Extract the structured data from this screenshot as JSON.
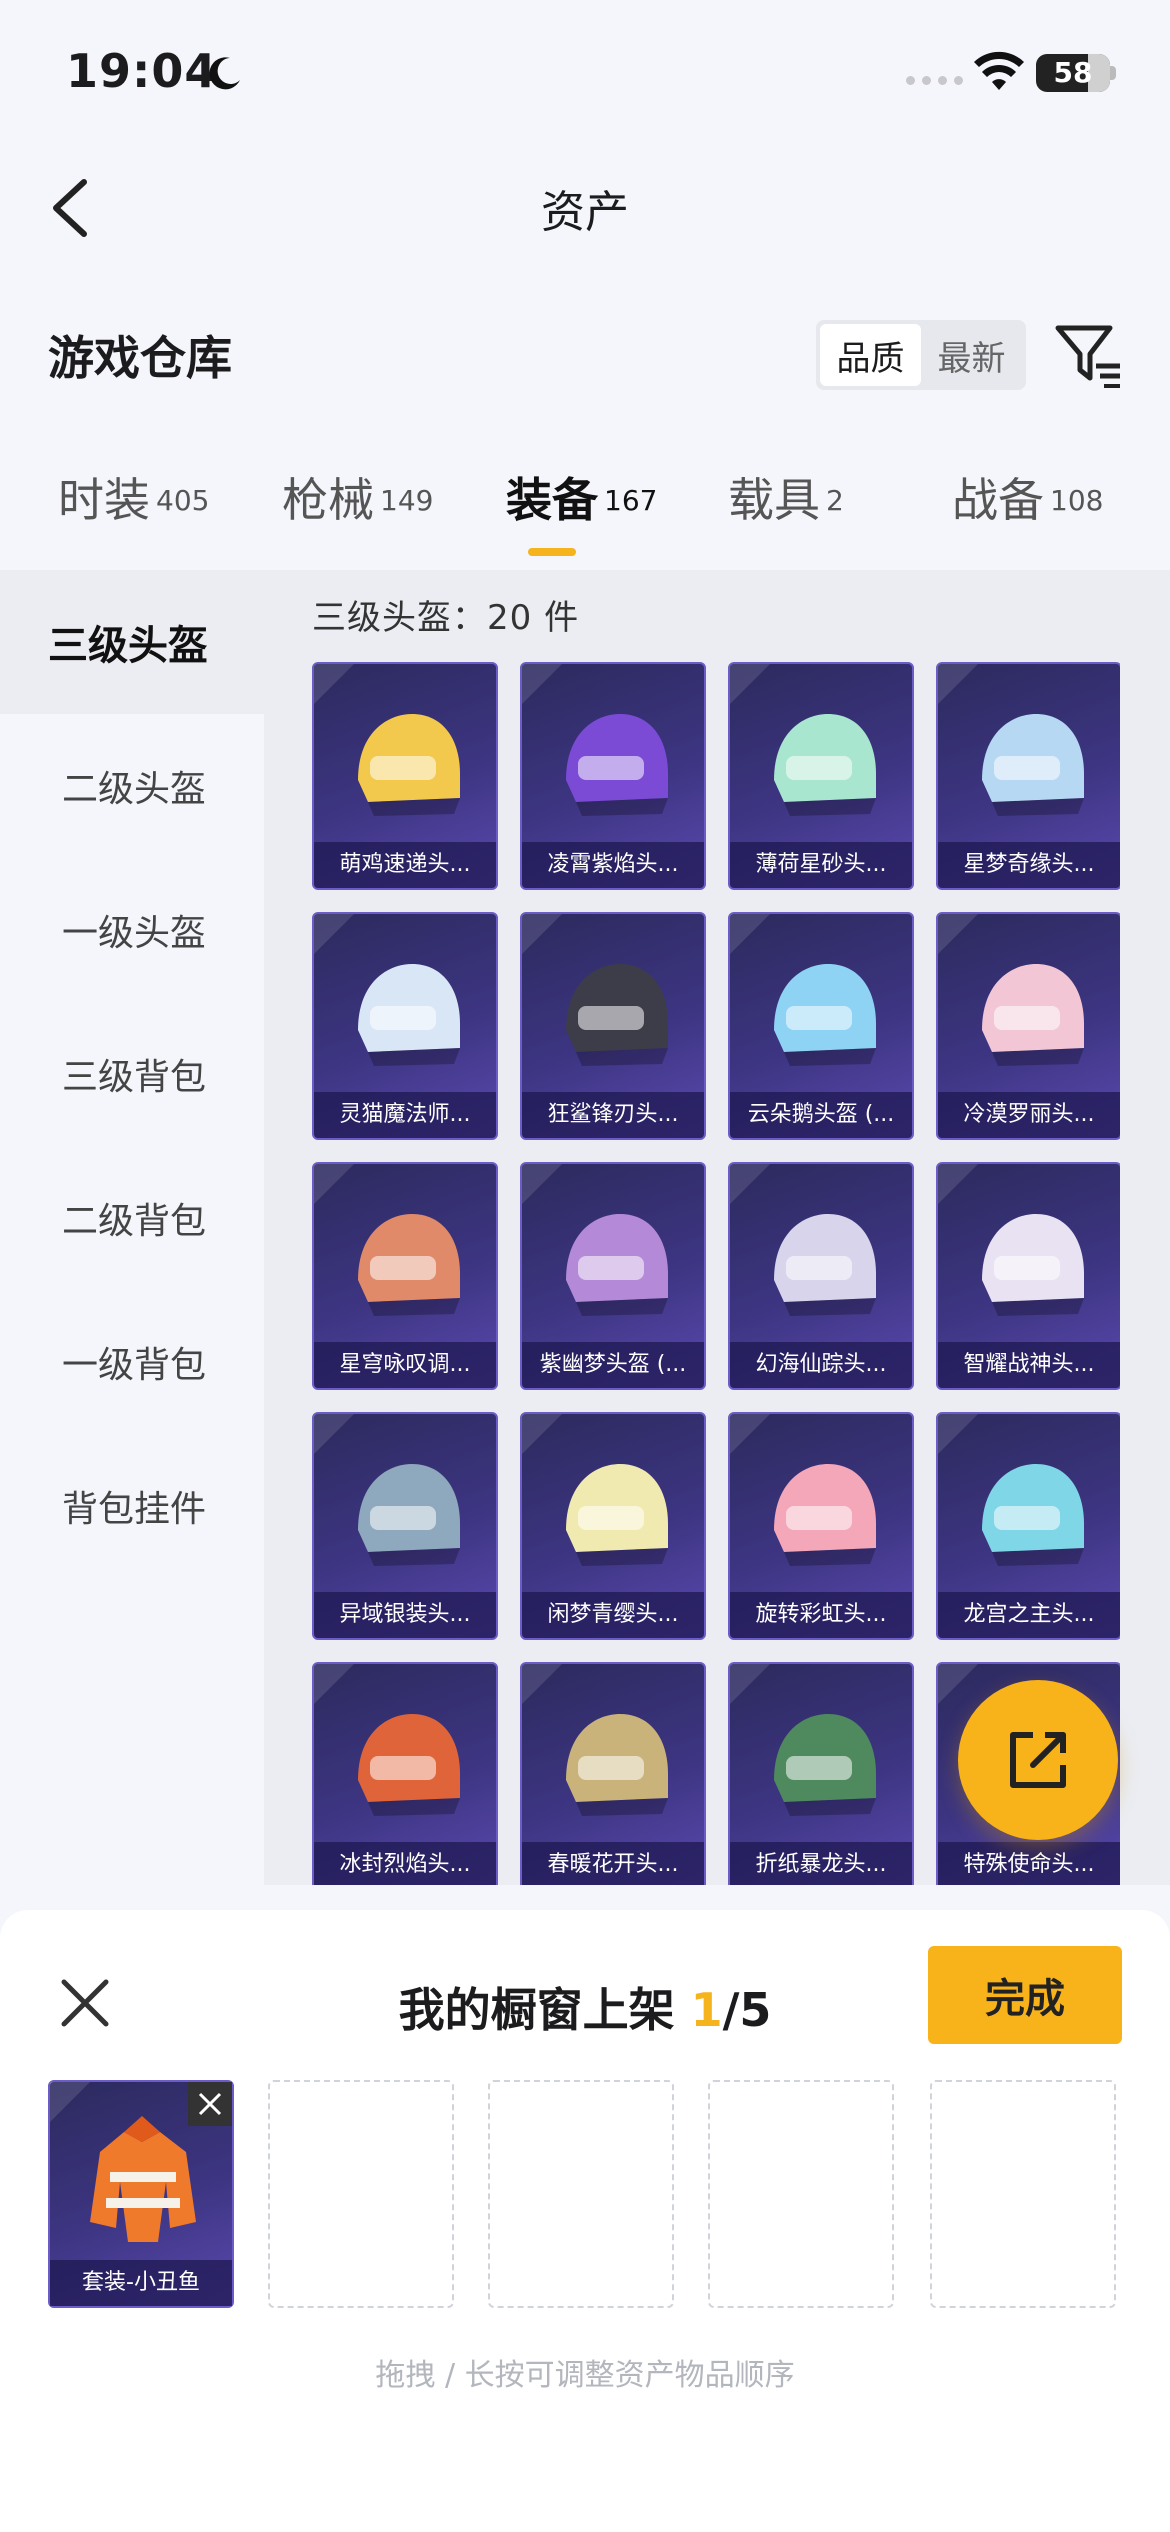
{
  "status_bar": {
    "time": "19:04",
    "battery": "58"
  },
  "nav": {
    "title": "资产"
  },
  "section": {
    "title": "游戏仓库",
    "sort_options": [
      "品质",
      "最新"
    ]
  },
  "tabs": [
    {
      "label": "时装",
      "count": "405"
    },
    {
      "label": "枪械",
      "count": "149"
    },
    {
      "label": "装备",
      "count": "167"
    },
    {
      "label": "载具",
      "count": "2"
    },
    {
      "label": "战备",
      "count": "108"
    }
  ],
  "sidebar": [
    {
      "label": "三级头盔"
    },
    {
      "label": "二级头盔"
    },
    {
      "label": "一级头盔"
    },
    {
      "label": "三级背包"
    },
    {
      "label": "二级背包"
    },
    {
      "label": "一级背包"
    },
    {
      "label": "背包挂件"
    }
  ],
  "grid": {
    "header": "三级头盔：20 件",
    "items": [
      {
        "label": "萌鸡速递头...",
        "color": "#f2c94c"
      },
      {
        "label": "凌霄紫焰头...",
        "color": "#7b4bd6"
      },
      {
        "label": "薄荷星砂头...",
        "color": "#a8e6cf"
      },
      {
        "label": "星梦奇缘头...",
        "color": "#b6d8f2"
      },
      {
        "label": "灵猫魔法师...",
        "color": "#d9e6f5"
      },
      {
        "label": "狂鲨锋刃头...",
        "color": "#3d3d4a"
      },
      {
        "label": "云朵鹅头盔 (...",
        "color": "#8fd3f4"
      },
      {
        "label": "冷漠罗丽头...",
        "color": "#f2c6d4"
      },
      {
        "label": "星穹咏叹调...",
        "color": "#e08a6a"
      },
      {
        "label": "紫幽梦头盔 (...",
        "color": "#b48ad8"
      },
      {
        "label": "幻海仙踪头...",
        "color": "#d8d4ec"
      },
      {
        "label": "智耀战神头...",
        "color": "#e9e2f3"
      },
      {
        "label": "异域银装头...",
        "color": "#8ea8bd"
      },
      {
        "label": "闲梦青缨头...",
        "color": "#f1eab0"
      },
      {
        "label": "旋转彩虹头...",
        "color": "#f4a7b9"
      },
      {
        "label": "龙宫之主头...",
        "color": "#7fd6e6"
      },
      {
        "label": "冰封烈焰头...",
        "color": "#e0643a"
      },
      {
        "label": "春暖花开头...",
        "color": "#c9b37a"
      },
      {
        "label": "折纸暴龙头...",
        "color": "#4f8a5e"
      },
      {
        "label": "特殊使命头...",
        "color": "#5c6270"
      }
    ]
  },
  "sheet": {
    "title_prefix": "我的橱窗上架 ",
    "title_count": "1",
    "title_total": "/5",
    "done_label": "完成",
    "slots": [
      {
        "label": "套装-小丑鱼",
        "filled": true
      },
      {
        "filled": false
      },
      {
        "filled": false
      },
      {
        "filled": false
      },
      {
        "filled": false
      }
    ],
    "hint": "拖拽 / 长按可调整资产物品顺序"
  }
}
